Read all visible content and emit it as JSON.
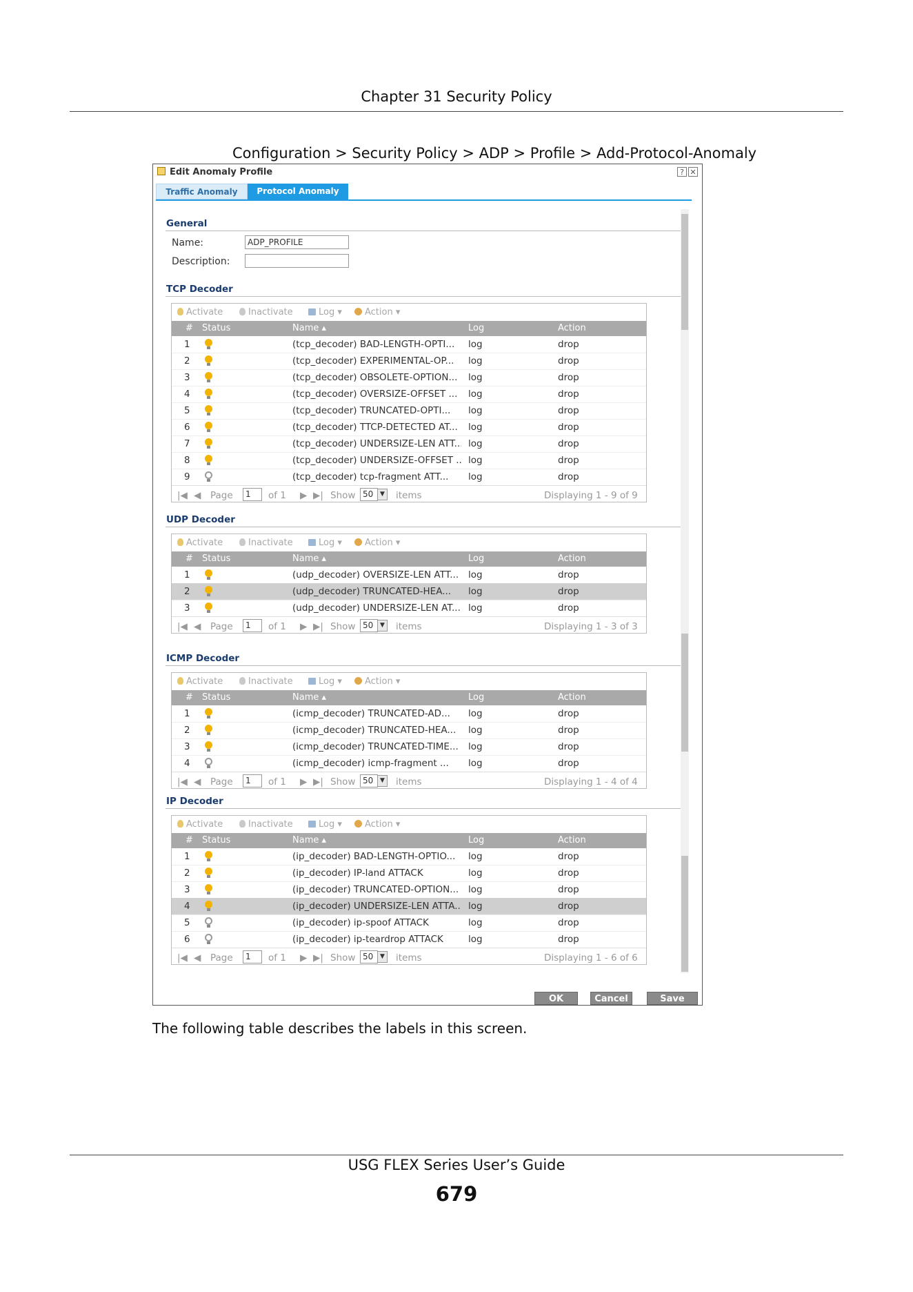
{
  "page": {
    "header": "Chapter 31 Security Policy",
    "caption": "Configuration > Security Policy > ADP > Profile > Add-Protocol-Anomaly",
    "body_text": "The following table describes the labels in this screen.",
    "footer": "USG FLEX Series User’s Guide",
    "page_number": "679"
  },
  "dialog": {
    "title": "Edit Anomaly Profile",
    "help_icon": "?",
    "close_icon": "✕",
    "tabs": [
      "Traffic Anomaly",
      "Protocol Anomaly"
    ],
    "active_tab": "Protocol Anomaly",
    "general": {
      "title": "General",
      "name_label": "Name:",
      "name_value": "ADP_PROFILE",
      "description_label": "Description:",
      "description_value": ""
    },
    "toolbar": {
      "activate": "Activate",
      "inactivate": "Inactivate",
      "log": "Log ▾",
      "action": "Action ▾"
    },
    "columns": {
      "num": "#",
      "status": "Status",
      "name": "Name ▴",
      "log": "Log",
      "action": "Action"
    },
    "pager": {
      "page_label": "Page",
      "of_label": "of 1",
      "page_value": "1",
      "show_label": "Show",
      "show_value": "50",
      "items_label": "items"
    },
    "sections": [
      {
        "title": "TCP Decoder",
        "display": "Displaying 1 - 9 of 9",
        "rows": [
          {
            "num": "1",
            "active": true,
            "name": "(tcp_decoder) BAD-LENGTH-OPTI...",
            "log": "log",
            "action": "drop",
            "selected": false
          },
          {
            "num": "2",
            "active": true,
            "name": "(tcp_decoder) EXPERIMENTAL-OP...",
            "log": "log",
            "action": "drop",
            "selected": false
          },
          {
            "num": "3",
            "active": true,
            "name": "(tcp_decoder) OBSOLETE-OPTION...",
            "log": "log",
            "action": "drop",
            "selected": false
          },
          {
            "num": "4",
            "active": true,
            "name": "(tcp_decoder) OVERSIZE-OFFSET ...",
            "log": "log",
            "action": "drop",
            "selected": false
          },
          {
            "num": "5",
            "active": true,
            "name": "(tcp_decoder) TRUNCATED-OPTI...",
            "log": "log",
            "action": "drop",
            "selected": false
          },
          {
            "num": "6",
            "active": true,
            "name": "(tcp_decoder) TTCP-DETECTED AT...",
            "log": "log",
            "action": "drop",
            "selected": false
          },
          {
            "num": "7",
            "active": true,
            "name": "(tcp_decoder) UNDERSIZE-LEN ATT...",
            "log": "log",
            "action": "drop",
            "selected": false
          },
          {
            "num": "8",
            "active": true,
            "name": "(tcp_decoder) UNDERSIZE-OFFSET ...",
            "log": "log",
            "action": "drop",
            "selected": false
          },
          {
            "num": "9",
            "active": false,
            "name": "(tcp_decoder) tcp-fragment ATT...",
            "log": "log",
            "action": "drop",
            "selected": false
          }
        ]
      },
      {
        "title": "UDP Decoder",
        "display": "Displaying 1 - 3 of 3",
        "rows": [
          {
            "num": "1",
            "active": true,
            "name": "(udp_decoder) OVERSIZE-LEN ATT...",
            "log": "log",
            "action": "drop",
            "selected": false
          },
          {
            "num": "2",
            "active": true,
            "name": "(udp_decoder) TRUNCATED-HEA...",
            "log": "log",
            "action": "drop",
            "selected": true
          },
          {
            "num": "3",
            "active": true,
            "name": "(udp_decoder) UNDERSIZE-LEN AT...",
            "log": "log",
            "action": "drop",
            "selected": false
          }
        ]
      },
      {
        "title": "ICMP Decoder",
        "display": "Displaying 1 - 4 of 4",
        "rows": [
          {
            "num": "1",
            "active": true,
            "name": "(icmp_decoder) TRUNCATED-AD...",
            "log": "log",
            "action": "drop",
            "selected": false
          },
          {
            "num": "2",
            "active": true,
            "name": "(icmp_decoder) TRUNCATED-HEA...",
            "log": "log",
            "action": "drop",
            "selected": false
          },
          {
            "num": "3",
            "active": true,
            "name": "(icmp_decoder) TRUNCATED-TIME...",
            "log": "log",
            "action": "drop",
            "selected": false
          },
          {
            "num": "4",
            "active": false,
            "name": "(icmp_decoder) icmp-fragment ...",
            "log": "log",
            "action": "drop",
            "selected": false
          }
        ]
      },
      {
        "title": "IP Decoder",
        "display": "Displaying 1 - 6 of 6",
        "rows": [
          {
            "num": "1",
            "active": true,
            "name": "(ip_decoder) BAD-LENGTH-OPTIO...",
            "log": "log",
            "action": "drop",
            "selected": false
          },
          {
            "num": "2",
            "active": true,
            "name": "(ip_decoder) IP-land ATTACK",
            "log": "log",
            "action": "drop",
            "selected": false
          },
          {
            "num": "3",
            "active": true,
            "name": "(ip_decoder) TRUNCATED-OPTION...",
            "log": "log",
            "action": "drop",
            "selected": false
          },
          {
            "num": "4",
            "active": true,
            "name": "(ip_decoder) UNDERSIZE-LEN ATTA...",
            "log": "log",
            "action": "drop",
            "selected": true
          },
          {
            "num": "5",
            "active": false,
            "name": "(ip_decoder) ip-spoof ATTACK",
            "log": "log",
            "action": "drop",
            "selected": false
          },
          {
            "num": "6",
            "active": false,
            "name": "(ip_decoder) ip-teardrop ATTACK",
            "log": "log",
            "action": "drop",
            "selected": false
          }
        ]
      }
    ],
    "buttons": {
      "ok": "OK",
      "cancel": "Cancel",
      "save": "Save"
    }
  }
}
